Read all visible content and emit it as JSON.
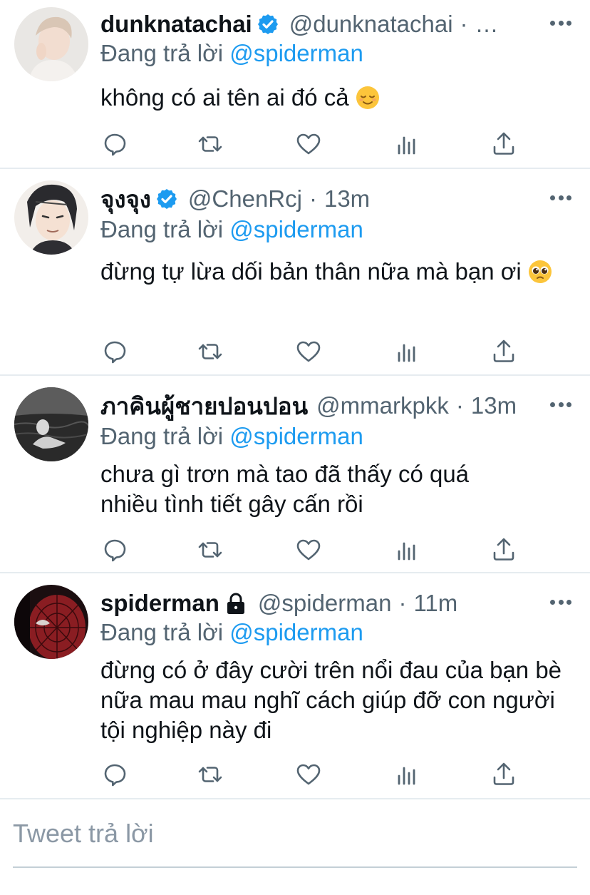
{
  "tweets": [
    {
      "name": "dunknatachai",
      "verified": true,
      "handle": "@dunknatachai",
      "sep": "·",
      "time": "…",
      "replying_prefix": "Đang trả lời",
      "replying_to": "@spiderman",
      "text": "không có ai tên ai đó cả",
      "emoji": "relieved-face"
    },
    {
      "name": "จุงจุง",
      "verified": true,
      "handle": "@ChenRcj",
      "sep": "·",
      "time": "13m",
      "replying_prefix": "Đang trả lời",
      "replying_to": "@spiderman",
      "text": "đừng tự lừa dối bản thân nữa mà bạn ơi",
      "emoji": "pleading-face"
    },
    {
      "name": "ภาคินผู้ชายปอนปอน",
      "verified": false,
      "handle": "@mmarkpkk",
      "sep": "·",
      "time": "13m",
      "replying_prefix": "Đang trả lời",
      "replying_to": "@spiderman",
      "text": "chưa gì trơn mà tao đã thấy có quá nhiều tình tiết gây cấn rồi"
    },
    {
      "name": "spiderman",
      "verified": false,
      "protected": true,
      "handle": "@spiderman",
      "sep": "·",
      "time": "11m",
      "replying_prefix": "Đang trả lời",
      "replying_to": "@spiderman",
      "text": "đừng có ở đây cười trên nổi đau của bạn bè nữa mau mau nghĩ cách giúp đỡ con người tội nghiệp này đi"
    }
  ],
  "compose": {
    "placeholder": "Tweet trả lời"
  },
  "colors": {
    "accent": "#1d9bf0",
    "secondary_text": "#536471",
    "divider": "#e6ecf0"
  },
  "icons": [
    "reply-icon",
    "retweet-icon",
    "like-icon",
    "analytics-icon",
    "share-icon",
    "more-icon",
    "verified-badge-icon",
    "lock-icon"
  ]
}
